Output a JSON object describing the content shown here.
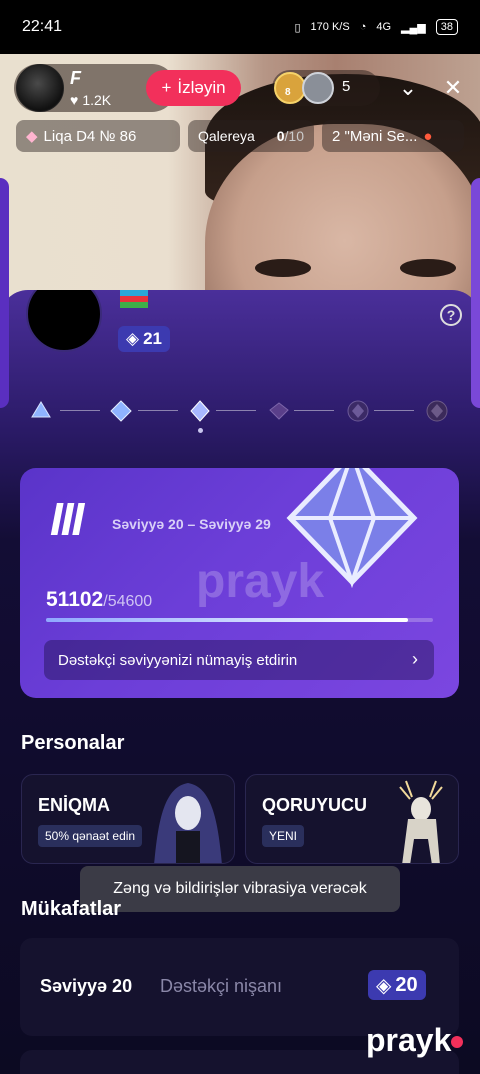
{
  "status_bar": {
    "time": "22:41",
    "net_speed": "170 K/S",
    "network": "4G",
    "battery": "38"
  },
  "host": {
    "name": "F",
    "likes": "1.2K",
    "follow_label": "İzləyin"
  },
  "viewers": {
    "count": "5",
    "badge": "8"
  },
  "chips": {
    "league": "Liqa D4 № 86",
    "gallery_label": "Qalereya",
    "gallery_count": "0",
    "gallery_total": "/10",
    "song": "2 \"Məni Se..."
  },
  "sheet": {
    "level": "21",
    "help": "?",
    "card": {
      "roman": "III",
      "range": "Səviyyə 20 – Səviyyə 29",
      "watermark": "prayk",
      "current": "51102",
      "max": "/54600",
      "progress_fraction": 0.936,
      "show_label": "Dəstəkçi səviyyənizi nümayiş etdirin"
    },
    "personas_title": "Personalar",
    "personas": [
      {
        "name": "ENİQMA",
        "tag": "50% qənaət edin"
      },
      {
        "name": "QORUYUCU",
        "tag": "YENI"
      }
    ],
    "rewards_title": "Mükafatlar",
    "reward": {
      "level": "Səviyyə 20",
      "desc": "Dəstəkçi nişanı",
      "value": "20"
    }
  },
  "toast": "Zəng və bildirişlər vibrasiya verəcək",
  "brand": "prayk",
  "colors": {
    "accent": "#f2305b",
    "sheet": "#130d35",
    "card": "#6c3ed8",
    "level_pill": "#3c3ab0"
  }
}
